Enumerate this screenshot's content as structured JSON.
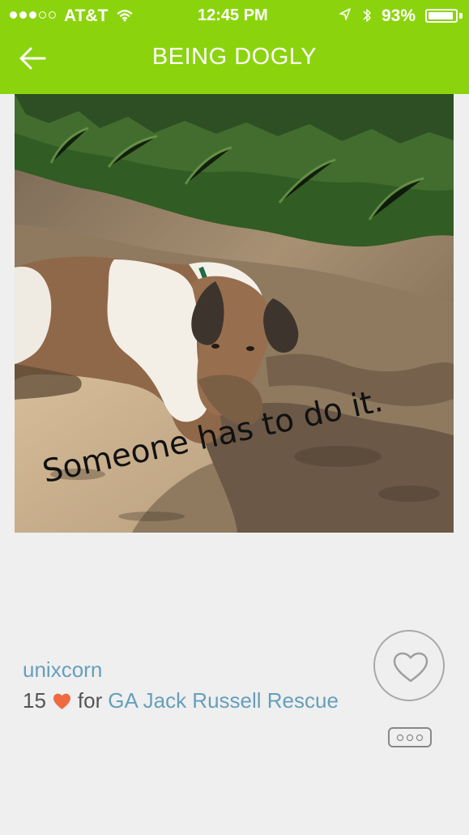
{
  "status_bar": {
    "carrier": "AT&T",
    "time": "12:45 PM",
    "battery": "93%",
    "battery_level": 0.93,
    "signal_filled": 3,
    "signal_total": 5,
    "icons": [
      "signal-dots-icon",
      "wifi-icon",
      "location-arrow-icon",
      "bluetooth-icon",
      "battery-icon"
    ]
  },
  "nav": {
    "title": "BEING DOGLY",
    "back_icon": "back-arrow-icon",
    "bar_color": "#8bd40d"
  },
  "post": {
    "caption": "Someone has to do it.",
    "username": "unixcorn",
    "count": "15",
    "count_icon": "heart-icon",
    "for_text": "for",
    "organization": "GA Jack Russell Rescue",
    "like_icon": "heart-outline-icon",
    "more_icon": "more-dots-icon",
    "accent_color": "#669fbc",
    "heart_color": "#f06a3f"
  }
}
